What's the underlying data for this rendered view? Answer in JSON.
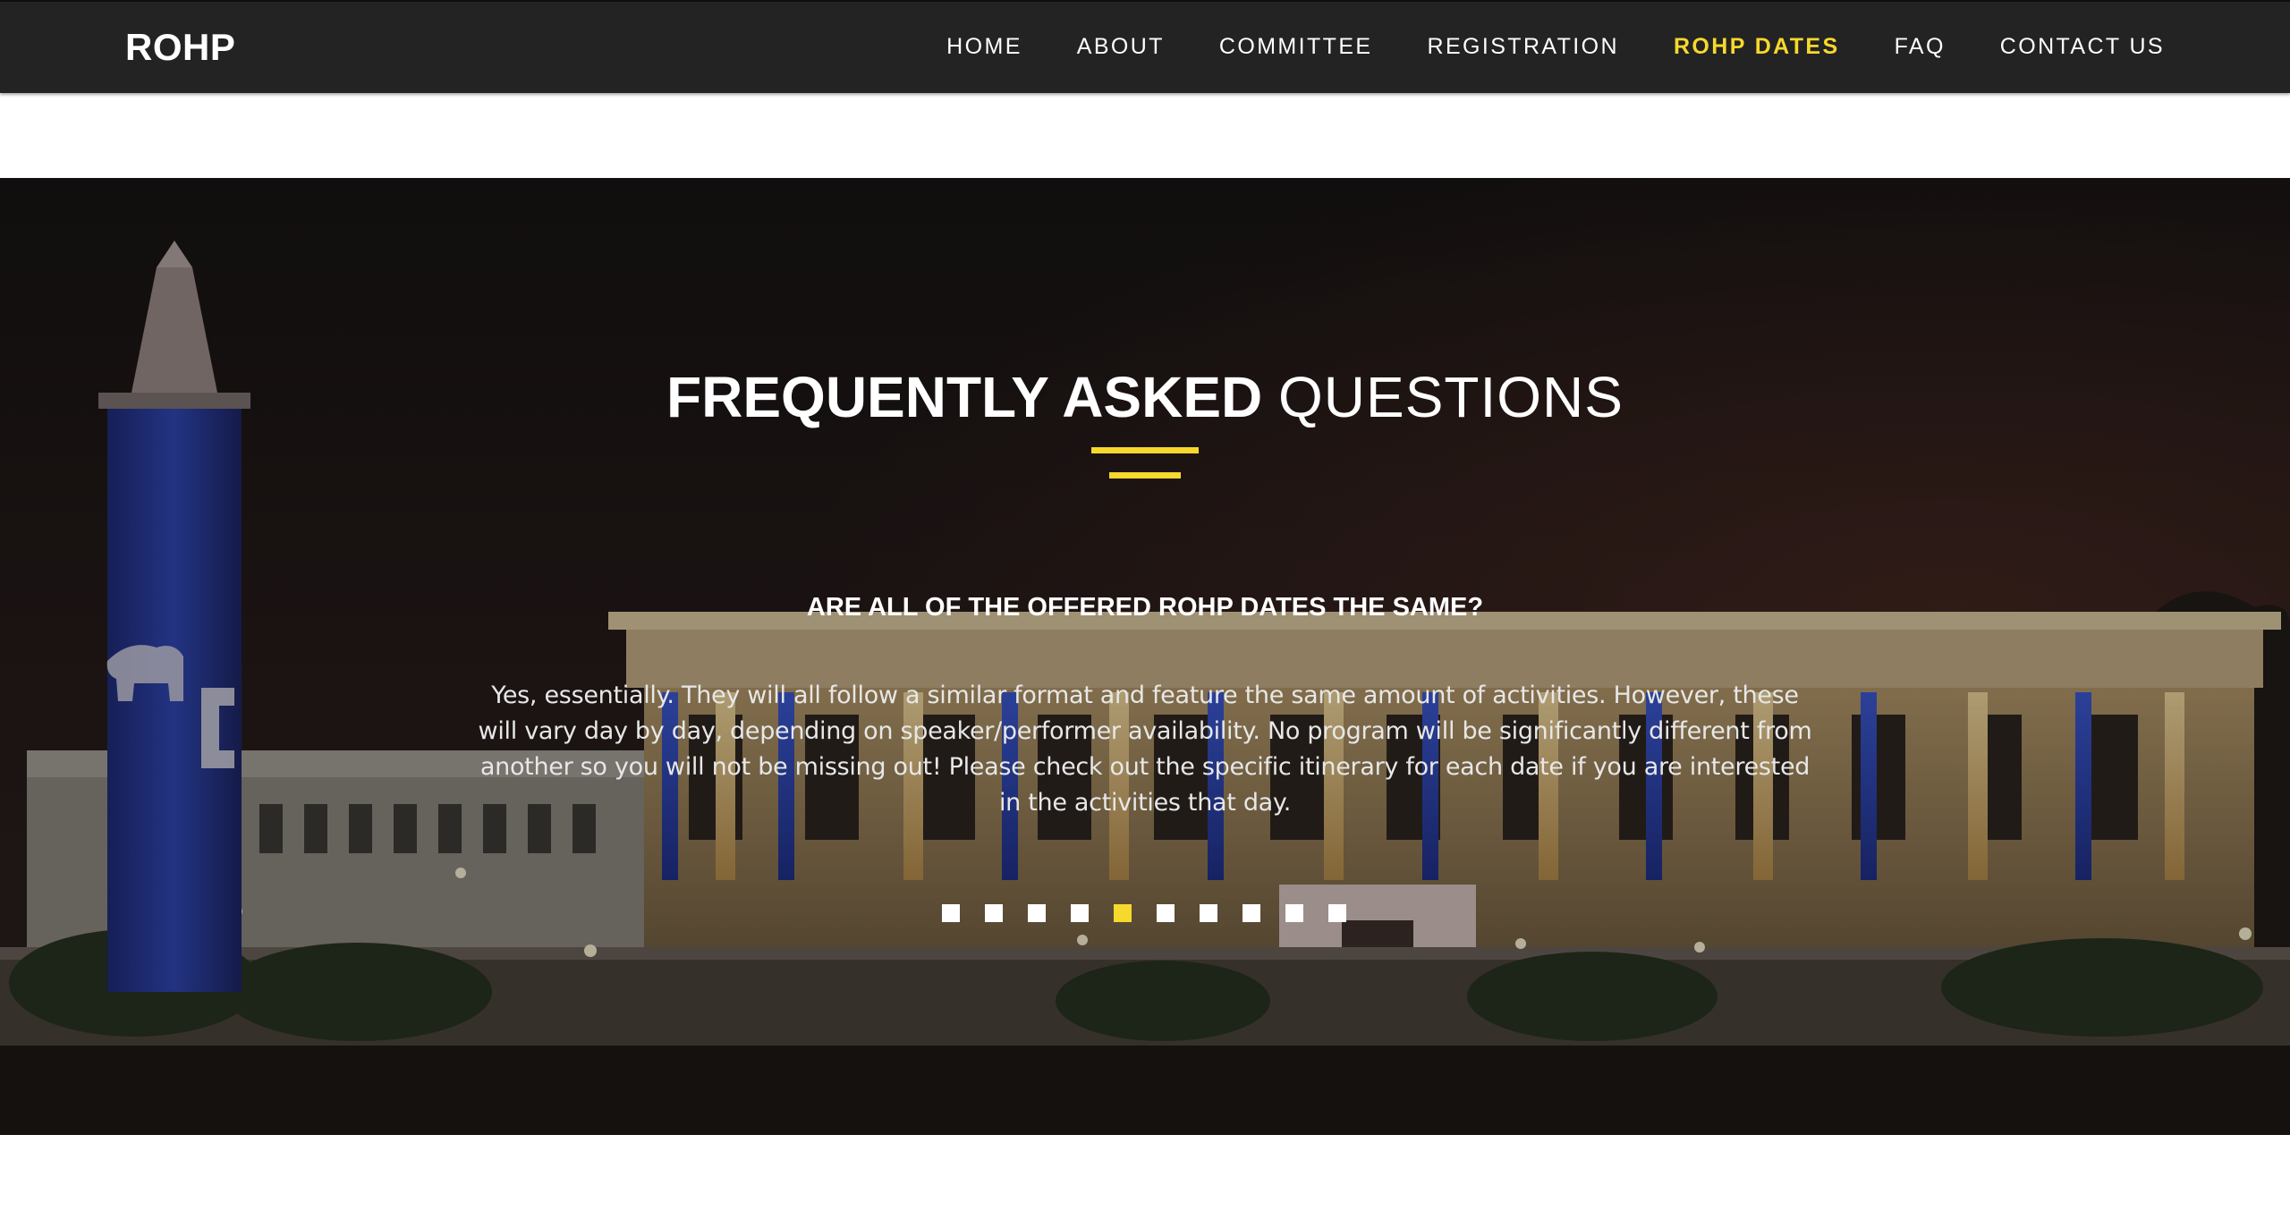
{
  "brand": {
    "logo_text": "ROHP",
    "accent_color": "#f7d82c"
  },
  "nav": {
    "items": [
      {
        "label": "HOME"
      },
      {
        "label": "ABOUT"
      },
      {
        "label": "COMMITTEE"
      },
      {
        "label": "REGISTRATION"
      },
      {
        "label": "ROHP DATES",
        "active": true
      },
      {
        "label": "FAQ"
      },
      {
        "label": "CONTACT US"
      }
    ]
  },
  "faq": {
    "title_bold": "FREQUENTLY ASKED",
    "title_light": "QUESTIONS",
    "question": "ARE ALL OF THE OFFERED ROHP DATES THE SAME?",
    "answer": "Yes, essentially. They will all follow a similar format and feature the same amount of activities. However, these will vary day by day, depending on speaker/performer availability. No program will be significantly different from another so you will not be missing out! Please check out the specific itinerary for each date if you are interested in the activities that day.",
    "slides_total": 10,
    "active_slide": 5
  }
}
